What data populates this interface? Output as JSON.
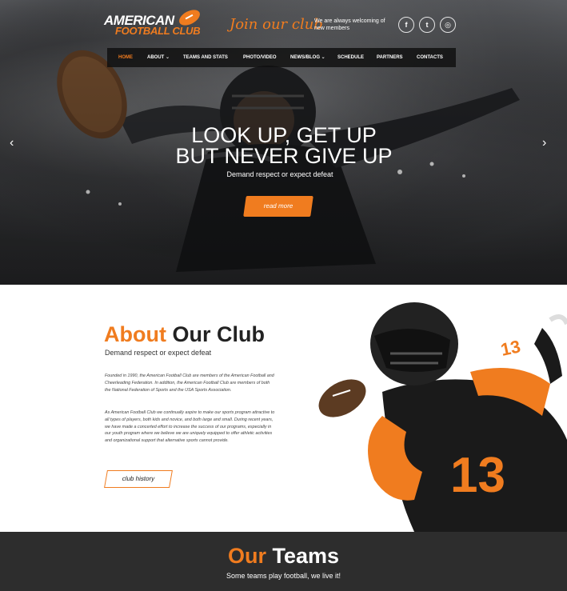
{
  "brand": {
    "logo_line1": "AMERICAN",
    "logo_line2": "FOOTBALL CLUB",
    "accent_color": "#f07c1f"
  },
  "header": {
    "join_text": "Join our club",
    "welcome_text": "We are always welcoming of new members",
    "social": [
      {
        "icon": "facebook-icon",
        "glyph": "f"
      },
      {
        "icon": "twitter-icon",
        "glyph": "t"
      },
      {
        "icon": "instagram-icon",
        "glyph": "◎"
      }
    ]
  },
  "nav": {
    "items": [
      {
        "label": "HOME",
        "active": true
      },
      {
        "label": "ABOUT",
        "dropdown": true
      },
      {
        "label": "TEAMS AND STATS"
      },
      {
        "label": "PHOTO/VIDEO"
      },
      {
        "label": "NEWS/BLOG",
        "dropdown": true
      },
      {
        "label": "SCHEDULE"
      },
      {
        "label": "PARTNERS"
      },
      {
        "label": "CONTACTS"
      }
    ]
  },
  "hero": {
    "headline_line1": "LOOK UP, GET UP",
    "headline_line2": "BUT NEVER GIVE UP",
    "subline": "Demand respect or expect defeat",
    "button_label": "read more",
    "prev_icon": "chevron-left-icon",
    "next_icon": "chevron-right-icon"
  },
  "about": {
    "title_accent": "About",
    "title_rest": "Our Club",
    "subtitle": "Demand respect or expect defeat",
    "paragraph1": "Founded in 1990, the American Football Club are members of the American Football and Cheerleading Federation. In addition, the American Football Club are members of both the National Federation of Sports and the USA Sports Association.",
    "paragraph2": "As American Football Club we continually aspire to make our sports program attractive to all types of players, both kids and novice, and both large and small. During recent years, we have made a concerted effort to increase the success of our programs, especially in our youth program where we believe we are uniquely equipped to offer athletic activities and organizational support that alternative sports cannot provide.",
    "button_label": "club history"
  },
  "teams": {
    "title_accent": "Our",
    "title_rest": "Teams",
    "subtitle": "Some teams play football, we live it!"
  }
}
